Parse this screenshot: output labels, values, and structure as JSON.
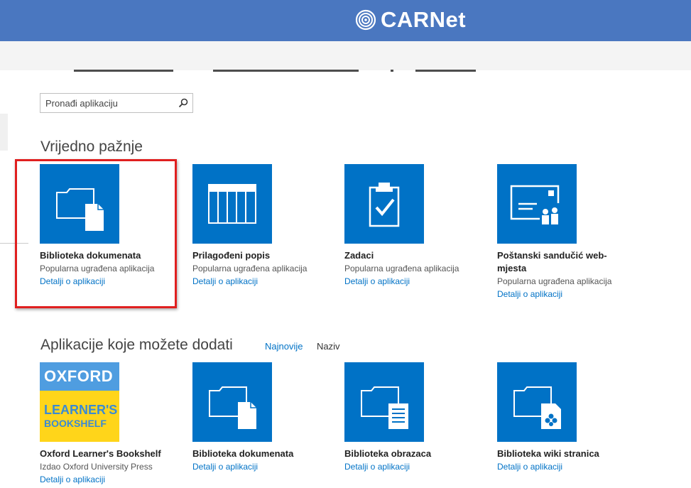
{
  "brand": {
    "name": "CARNet",
    "logo_icon": "carnet-swirl-icon"
  },
  "search": {
    "placeholder": "Pronađi aplikaciju",
    "icon": "search-icon"
  },
  "noteworthy": {
    "heading": "Vrijedno pažnje",
    "apps": [
      {
        "title": "Biblioteka dokumenata",
        "subtitle": "Popularna ugrađena aplikacija",
        "link": "Detalji o aplikaciji",
        "icon": "document-library-icon"
      },
      {
        "title": "Prilagođeni popis",
        "subtitle": "Popularna ugrađena aplikacija",
        "link": "Detalji o aplikaciji",
        "icon": "custom-list-icon"
      },
      {
        "title": "Zadaci",
        "subtitle": "Popularna ugrađena aplikacija",
        "link": "Detalji o aplikaciji",
        "icon": "tasks-clipboard-icon"
      },
      {
        "title": "Poštanski sandučić web-mjesta",
        "subtitle": "Popularna ugrađena aplikacija",
        "link": "Detalji o aplikaciji",
        "icon": "site-mailbox-icon"
      }
    ]
  },
  "addable": {
    "heading": "Aplikacije koje možete dodati",
    "sort_newest": "Najnovije",
    "sort_name": "Naziv",
    "apps": [
      {
        "title": "Oxford Learner's Bookshelf",
        "subtitle": "Izdao Oxford University Press",
        "link": "Detalji o aplikaciji",
        "logo_line1": "OXFORD",
        "logo_line2": "LEARNER'S",
        "logo_line3": "BOOKSHELF"
      },
      {
        "title": "Biblioteka dokumenata",
        "link": "Detalji o aplikaciji",
        "icon": "document-library-icon"
      },
      {
        "title": "Biblioteka obrazaca",
        "link": "Detalji o aplikaciji",
        "icon": "form-library-icon"
      },
      {
        "title": "Biblioteka wiki stranica",
        "link": "Detalji o aplikaciji",
        "icon": "wiki-page-library-icon"
      }
    ]
  },
  "colors": {
    "header_blue": "#4a77c0",
    "tile_blue": "#0072c6",
    "link_blue": "#0072c6",
    "highlight_red": "#e02020",
    "oxford_blue": "#4f9de0",
    "oxford_yellow": "#ffd51a"
  }
}
